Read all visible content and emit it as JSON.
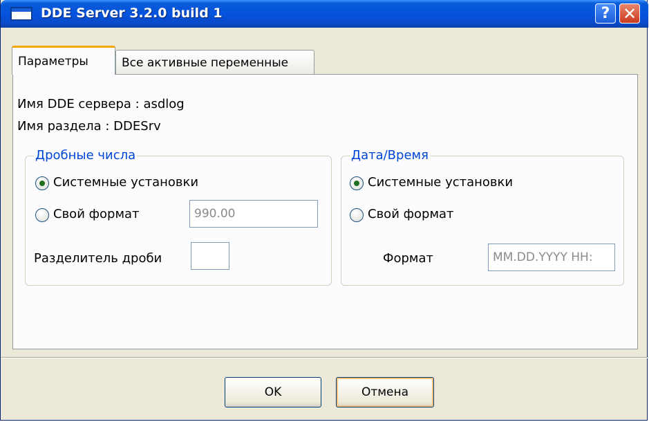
{
  "window": {
    "title": "DDE Server 3.2.0 build 1",
    "help_glyph": "?",
    "close_glyph": "✕"
  },
  "tabs": [
    {
      "label": "Параметры",
      "active": true
    },
    {
      "label": "Все активные переменные",
      "active": false
    }
  ],
  "info": {
    "server_name_line": "Имя DDE сервера : asdlog",
    "section_name_line": "Имя раздела : DDESrv"
  },
  "fractional_numbers": {
    "legend": "Дробные числа",
    "system_settings_label": "Системные установки",
    "custom_format_label": "Свой формат",
    "custom_format_value": "990.00",
    "separator_label": "Разделитель дроби",
    "separator_value": "",
    "selected": "system"
  },
  "date_time": {
    "legend": "Дата/Время",
    "system_settings_label": "Системные установки",
    "custom_format_label": "Свой формат",
    "format_label": "Формат",
    "format_value": "MM.DD.YYYY HH:",
    "selected": "system"
  },
  "buttons": {
    "ok_label": "OK",
    "cancel_label": "Отмена"
  },
  "colors": {
    "titlebar": "#0453de",
    "legend_text": "#0046d5",
    "focus_ring": "#f4c07a"
  }
}
